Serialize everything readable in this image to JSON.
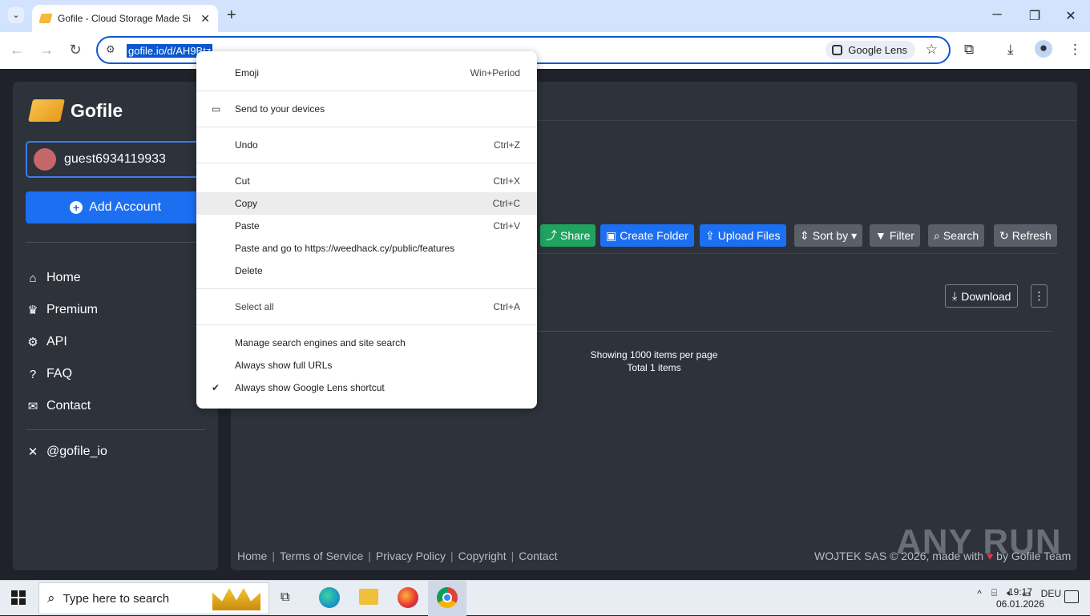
{
  "browser": {
    "tab_title": "Gofile - Cloud Storage Made Si",
    "url": "gofile.io/d/AH9Btz",
    "google_lens_label": "Google Lens",
    "new_tab_symbol": "+",
    "close_tab_symbol": "✕"
  },
  "sidebar": {
    "brand": "Gofile",
    "account_name": "guest6934119933",
    "add_account_label": "Add Account",
    "nav": [
      {
        "label": "Home",
        "icon": "home-icon"
      },
      {
        "label": "Premium",
        "icon": "crown-icon"
      },
      {
        "label": "API",
        "icon": "gears-icon"
      },
      {
        "label": "FAQ",
        "icon": "question-icon"
      },
      {
        "label": "Contact",
        "icon": "envelope-icon"
      }
    ],
    "social_label": "@gofile_io"
  },
  "toolbar": {
    "share": "Share",
    "create_folder": "Create Folder",
    "upload_files": "Upload Files",
    "sort_by": "Sort by",
    "filter": "Filter",
    "search": "Search",
    "refresh": "Refresh"
  },
  "content": {
    "download_label": "Download",
    "items_per_page": "Showing 1000 items per page",
    "total_items": "Total 1 items"
  },
  "footer": {
    "links": [
      "Home",
      "Terms of Service",
      "Privacy Policy",
      "Copyright",
      "Contact"
    ],
    "credits_prefix": "WOJTEK SAS © 2026, made with",
    "credits_suffix": "by Gofile Team"
  },
  "watermark": "ANY RUN",
  "context_menu": {
    "items": [
      {
        "label": "Emoji",
        "shortcut": "Win+Period"
      },
      {
        "label": "Send to your devices",
        "shortcut": ""
      },
      {
        "label": "Undo",
        "shortcut": "Ctrl+Z"
      },
      {
        "label": "Cut",
        "shortcut": "Ctrl+X"
      },
      {
        "label": "Copy",
        "shortcut": "Ctrl+C"
      },
      {
        "label": "Paste",
        "shortcut": "Ctrl+V"
      },
      {
        "label": "Paste and go to https://weedhack.cy/public/features",
        "shortcut": ""
      },
      {
        "label": "Delete",
        "shortcut": ""
      },
      {
        "label": "Select all",
        "shortcut": "Ctrl+A"
      },
      {
        "label": "Manage search engines and site search",
        "shortcut": ""
      },
      {
        "label": "Always show full URLs",
        "shortcut": ""
      },
      {
        "label": "Always show Google Lens shortcut",
        "shortcut": ""
      }
    ],
    "highlighted_item": "Copy"
  },
  "taskbar": {
    "search_placeholder": "Type here to search",
    "language": "DEU",
    "time": "19:17",
    "date": "06.01.2026"
  }
}
